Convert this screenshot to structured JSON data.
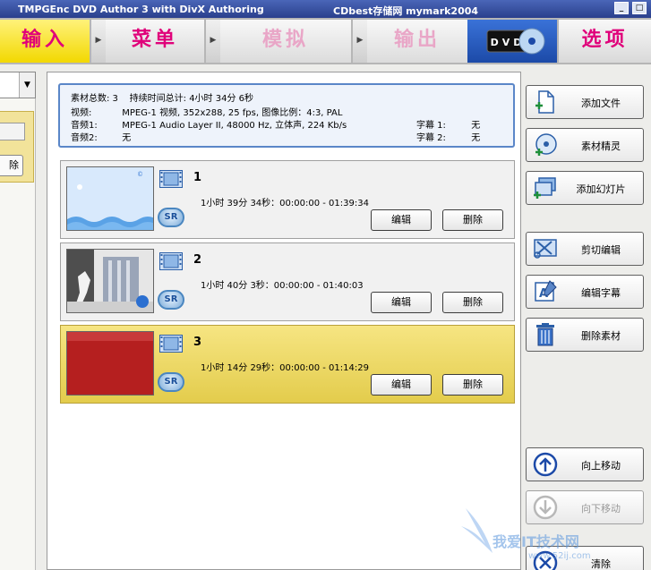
{
  "window": {
    "title": "TMPGEnc DVD Author 3 with DivX Authoring",
    "subtitle": "CDbest存储网 mymark2004"
  },
  "tabs": [
    {
      "label": "输入"
    },
    {
      "label": "菜单"
    },
    {
      "label": "模拟"
    },
    {
      "label": "输出"
    },
    {
      "label": "DVD"
    },
    {
      "label": "选项"
    }
  ],
  "left": {
    "button_label": "除"
  },
  "info": {
    "total_label": "素材总数: 3",
    "duration_label": "持续时间总计: 4小时 34分 6秒",
    "video_label": "视频:",
    "video_value": "MPEG-1 视频, 352x288, 25 fps, 图像比例：4:3, PAL",
    "audio1_label": "音频1:",
    "audio1_value": "MPEG-1 Audio Layer II, 48000 Hz, 立体声, 224 Kb/s",
    "audio2_label": "音频2:",
    "audio2_value": "无",
    "sub1_label": "字幕 1:",
    "sub1_value": "无",
    "sub2_label": "字幕 2:",
    "sub2_value": "无"
  },
  "clips": [
    {
      "number": "1",
      "duration": "1小时 39分 34秒：00:00:00 - 01:39:34",
      "edit_label": "编辑",
      "delete_label": "删除",
      "badge": "SR"
    },
    {
      "number": "2",
      "duration": "1小时 40分 3秒：00:00:00 - 01:40:03",
      "edit_label": "编辑",
      "delete_label": "删除",
      "badge": "SR"
    },
    {
      "number": "3",
      "duration": "1小时 14分 29秒：00:00:00 - 01:14:29",
      "edit_label": "编辑",
      "delete_label": "删除",
      "badge": "SR"
    }
  ],
  "actions": {
    "add_file": "添加文件",
    "wizard": "素材精灵",
    "add_slideshow": "添加幻灯片",
    "cut_edit": "剪切编辑",
    "edit_subtitle": "编辑字幕",
    "delete_clip": "删除素材",
    "move_up": "向上移动",
    "move_down": "向下移动",
    "clear": "清除"
  },
  "watermark": {
    "line1": "我爱IT技术网",
    "line2": "www.52ij.com"
  }
}
